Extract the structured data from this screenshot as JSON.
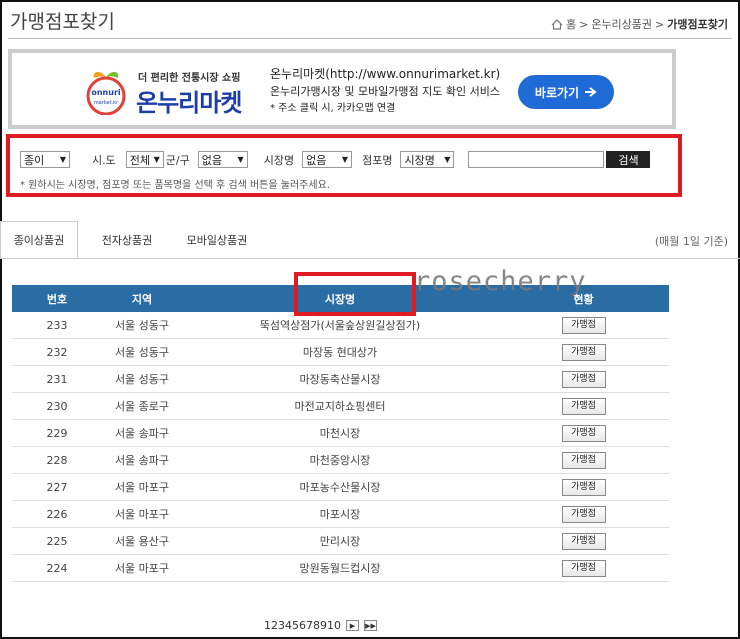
{
  "page": {
    "title": "가맹점포찾기",
    "breadcrumb": {
      "home": "홈",
      "parent": "온누리상품권",
      "current": "가맹점포찾기"
    }
  },
  "banner": {
    "logo_text": "onnuri market.kr",
    "slogan": "더 편리한 전통시장 쇼핑",
    "brand": "온누리마켓",
    "line1": "온누리마켓(http://www.onnurimarket.kr)",
    "line2": "온누리가맹시장 및 모바일가맹점 지도 확인 서비스",
    "note": "* 주소 클릭 시, 카카오맵 연결",
    "go_label": "바로가기"
  },
  "search": {
    "type_value": "종이",
    "sido_label": "시.도",
    "sido_value": "전체",
    "gungu_label": "군/구",
    "gungu_value": "없음",
    "market_label": "시장명",
    "market_value": "없음",
    "store_label": "점포명",
    "store_select_value": "시장명",
    "input_value": "",
    "button_label": "검색",
    "hint": "* 원하시는 시장명, 점포명 또는 품목명을 선택 후 검색 버튼을 눌러주세요."
  },
  "tabs": [
    {
      "label": "종이상품권",
      "active": true
    },
    {
      "label": "전자상품권",
      "active": false
    },
    {
      "label": "모바일상품권",
      "active": false
    }
  ],
  "monthly_note": "(매월 1일 기준)",
  "watermark": "rosecherry",
  "table": {
    "headers": {
      "no": "번호",
      "region": "지역",
      "market": "시장명",
      "status": "현황"
    },
    "button_label": "가맹점",
    "rows": [
      {
        "no": "233",
        "region": "서울 성동구",
        "market": "뚝섬역상점가(서울숲상원길상점가)"
      },
      {
        "no": "232",
        "region": "서울 성동구",
        "market": "마장동 현대상가"
      },
      {
        "no": "231",
        "region": "서울 성동구",
        "market": "마장동축산물시장"
      },
      {
        "no": "230",
        "region": "서울 종로구",
        "market": "마전교지하쇼핑센터"
      },
      {
        "no": "229",
        "region": "서울 송파구",
        "market": "마천시장"
      },
      {
        "no": "228",
        "region": "서울 송파구",
        "market": "마천중앙시장"
      },
      {
        "no": "227",
        "region": "서울 마포구",
        "market": "마포농수산물시장"
      },
      {
        "no": "226",
        "region": "서울 마포구",
        "market": "마포시장"
      },
      {
        "no": "225",
        "region": "서울 용산구",
        "market": "만리시장"
      },
      {
        "no": "224",
        "region": "서울 마포구",
        "market": "망원동월드컵시장"
      }
    ]
  },
  "pagination": {
    "pages": [
      "1",
      "2",
      "3",
      "4",
      "5",
      "6",
      "7",
      "8",
      "9",
      "10"
    ],
    "next_icon": "next-icon",
    "last_icon": "last-icon"
  },
  "colors": {
    "highlight": "#e01b22",
    "table_header": "#2a6ca4",
    "go_button": "#1f6bd6"
  }
}
